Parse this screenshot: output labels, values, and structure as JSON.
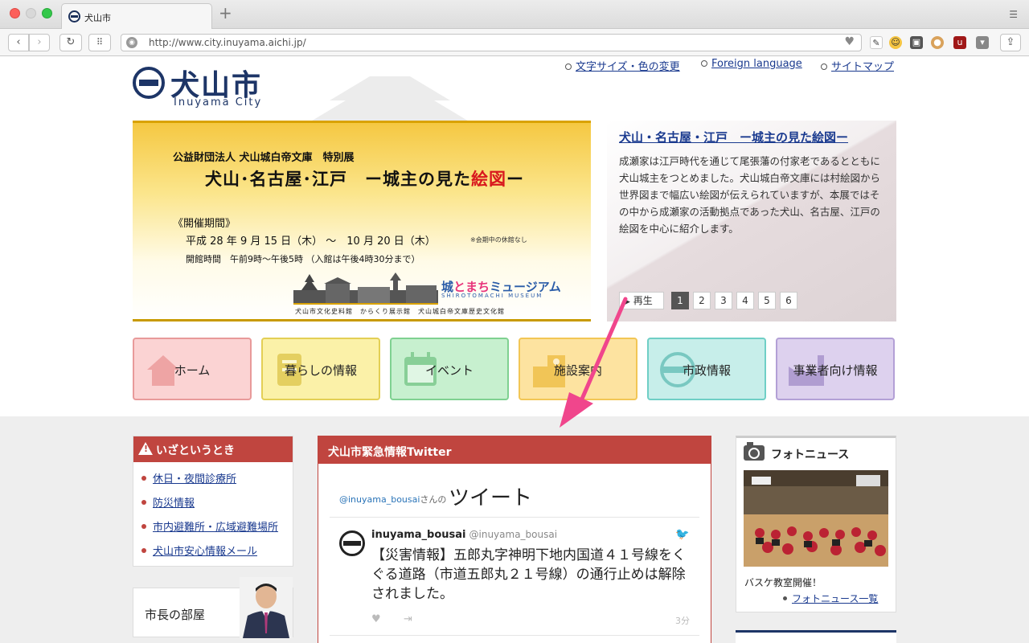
{
  "browser": {
    "tab_title": "犬山市",
    "new_tab": "+",
    "url": "http://www.city.inuyama.aichi.jp/"
  },
  "header": {
    "logo_kanji": "犬山市",
    "logo_roman": "Inuyama City",
    "util_links": [
      "文字サイズ・色の変更",
      "Foreign language",
      "サイトマップ"
    ]
  },
  "banner": {
    "org": "公益財団法人 犬山城白帝文庫　特別展",
    "title_before": "犬山･名古屋･江戸　ー城主の見た",
    "title_red": "絵図",
    "title_after": "ー",
    "period_label": "《開催期間》",
    "period": "平成 28 年 9 月 15 日（木） 〜　10 月 20 日（木）",
    "note": "※会期中の休館なし",
    "hours": "開館時間　午前9時〜午後5時 （入館は午後4時30分まで）",
    "museum_a": "城",
    "museum_b": "と",
    "museum_c": "まち",
    "museum_d": "ミュージアム",
    "museum_roman": "SHIROTOMACHI MUSEUM",
    "venues": "犬山市文化史料館　からくり展示館　犬山城白帝文庫歴史文化館"
  },
  "feature": {
    "title": "犬山・名古屋・江戸　ー城主の見た絵図ー",
    "text": "成瀬家は江戸時代を通じて尾張藩の付家老であるとともに犬山城主をつとめました。犬山城白帝文庫には村絵図から世界図まで幅広い絵図が伝えられていますが、本展ではその中から成瀬家の活動拠点であった犬山、名古屋、江戸の絵図を中心に紹介します。",
    "play_label": "再生",
    "pages": [
      "1",
      "2",
      "3",
      "4",
      "5",
      "6"
    ],
    "active_page": "1"
  },
  "nav": [
    {
      "label": "ホーム",
      "icon": "house-icon",
      "bg": "#fbd3d3",
      "border": "#e89a9a"
    },
    {
      "label": "暮らしの情報",
      "icon": "life-icon",
      "bg": "#fbf1a8",
      "border": "#e3cf55"
    },
    {
      "label": "イベント",
      "icon": "calendar-icon",
      "bg": "#c7f0cf",
      "border": "#7fd191"
    },
    {
      "label": "施設案内",
      "icon": "building-icon",
      "bg": "#fde3a0",
      "border": "#f2c655"
    },
    {
      "label": "市政情報",
      "icon": "city-emblem-icon",
      "bg": "#c7eeea",
      "border": "#6fcfc6"
    },
    {
      "label": "事業者向け情報",
      "icon": "factory-icon",
      "bg": "#ddd1ee",
      "border": "#b3a0d6"
    }
  ],
  "emergency": {
    "title": "いざというとき",
    "links": [
      "休日・夜間診療所",
      "防災情報",
      "市内避難所・広域避難場所",
      "犬山市安心情報メール"
    ]
  },
  "mayor": {
    "label": "市長の部屋"
  },
  "twitter": {
    "title": "犬山市緊急情報Twitter",
    "handle": "@inuyama_bousai",
    "handle_suffix": "さんの",
    "tweets_label": "ツイート",
    "tweet": {
      "name": "inuyama_bousai",
      "handle": "@inuyama_bousai",
      "text": "【災害情報】五郎丸字神明下地内国道４１号線をくぐる道路（市道五郎丸２１号線）の通行止めは解除されました。",
      "time": "3分"
    }
  },
  "photo_news": {
    "title": "フォトニュース",
    "caption": "バスケ教室開催！",
    "more": "フォトニュース一覧"
  },
  "colors": {
    "brand": "#1d3567",
    "accent_red": "#c0453f",
    "link": "#1a3a8f",
    "arrow": "#f0468c"
  }
}
